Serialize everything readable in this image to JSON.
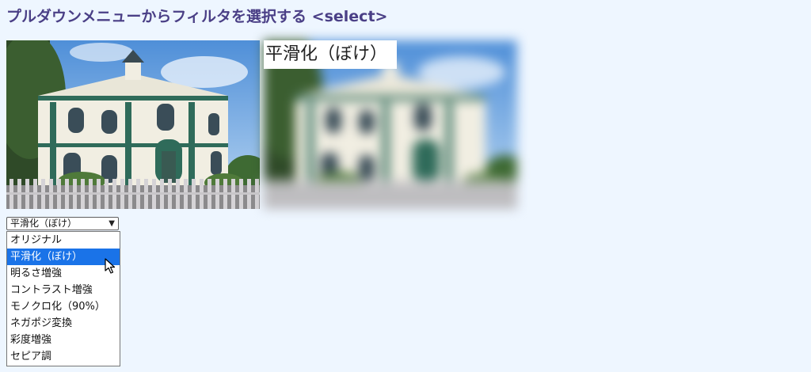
{
  "header": {
    "title": "プルダウンメニューからフィルタを選択する <select>"
  },
  "preview": {
    "original_image": "house-photo",
    "filtered_image": "house-photo-blurred",
    "applied_filter_label": "平滑化（ぼけ）"
  },
  "filter_select": {
    "selected_value": "平滑化（ぼけ）",
    "is_open": true,
    "highlighted_index": 1,
    "options": [
      "オリジナル",
      "平滑化（ぼけ）",
      "明るさ増強",
      "コントラスト増強",
      "モノクロ化（90%）",
      "ネガポジ変換",
      "彩度増強",
      "セピア調"
    ]
  },
  "colors": {
    "page_background": "#eef6ff",
    "title": "#4a3f86",
    "option_highlight": "#1a73e8"
  }
}
